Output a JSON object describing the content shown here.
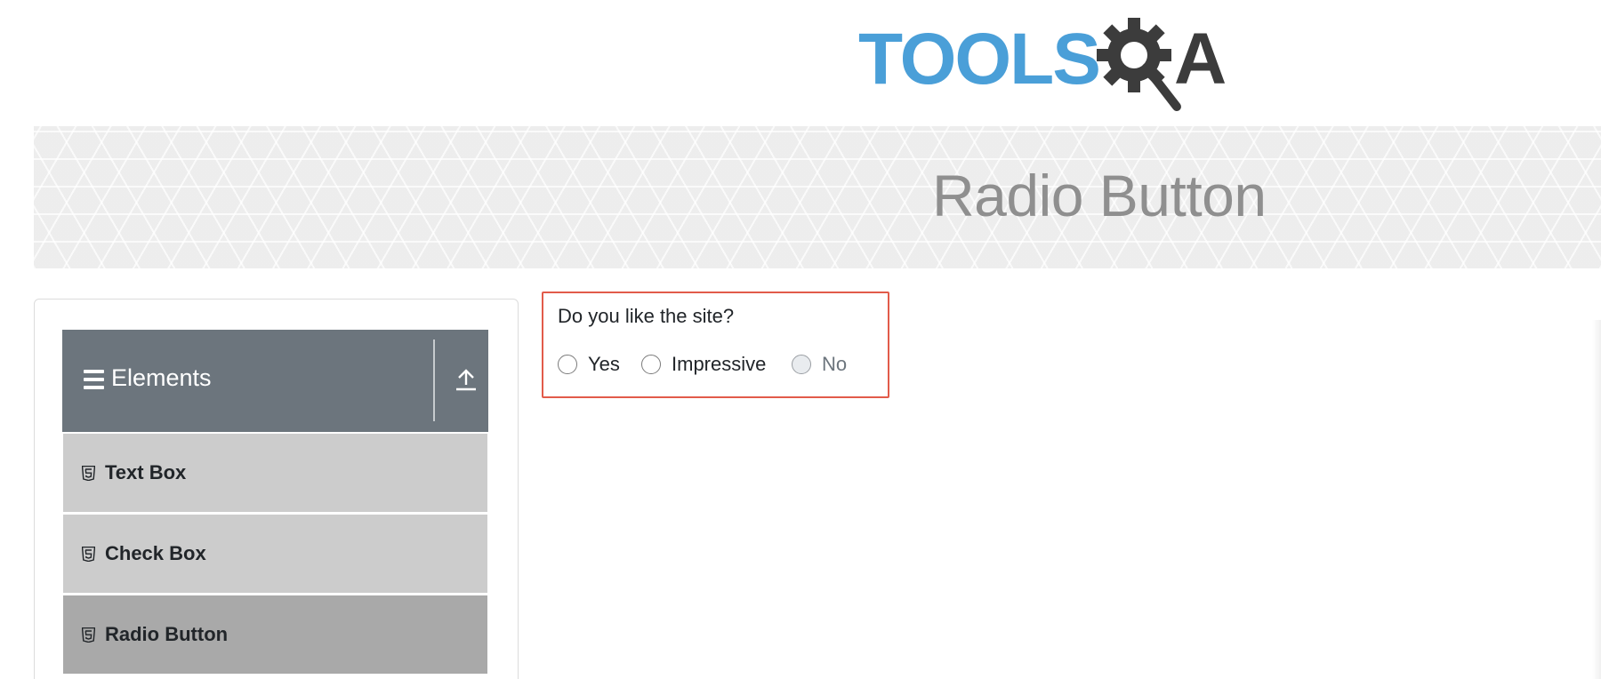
{
  "logo": {
    "text_part1": "TOOLS",
    "text_part2": "A",
    "primary_color": "#4a9fd8",
    "secondary_color": "#3c3c3c",
    "icon": "gear-magnifier-icon"
  },
  "banner": {
    "title": "Radio Button"
  },
  "sidebar": {
    "group": {
      "title": "Elements",
      "menu_icon": "hamburger-icon",
      "collapse_icon": "arrow-up-icon"
    },
    "items": [
      {
        "label": "Text Box",
        "icon": "html5-icon",
        "active": false
      },
      {
        "label": "Check Box",
        "icon": "html5-icon",
        "active": false
      },
      {
        "label": "Radio Button",
        "icon": "html5-icon",
        "active": true
      }
    ]
  },
  "radio_form": {
    "question": "Do you like the site?",
    "options": [
      {
        "label": "Yes",
        "checked": false,
        "disabled": false
      },
      {
        "label": "Impressive",
        "checked": false,
        "disabled": false
      },
      {
        "label": "No",
        "checked": false,
        "disabled": true
      }
    ],
    "highlight_color": "#e25b4a"
  }
}
